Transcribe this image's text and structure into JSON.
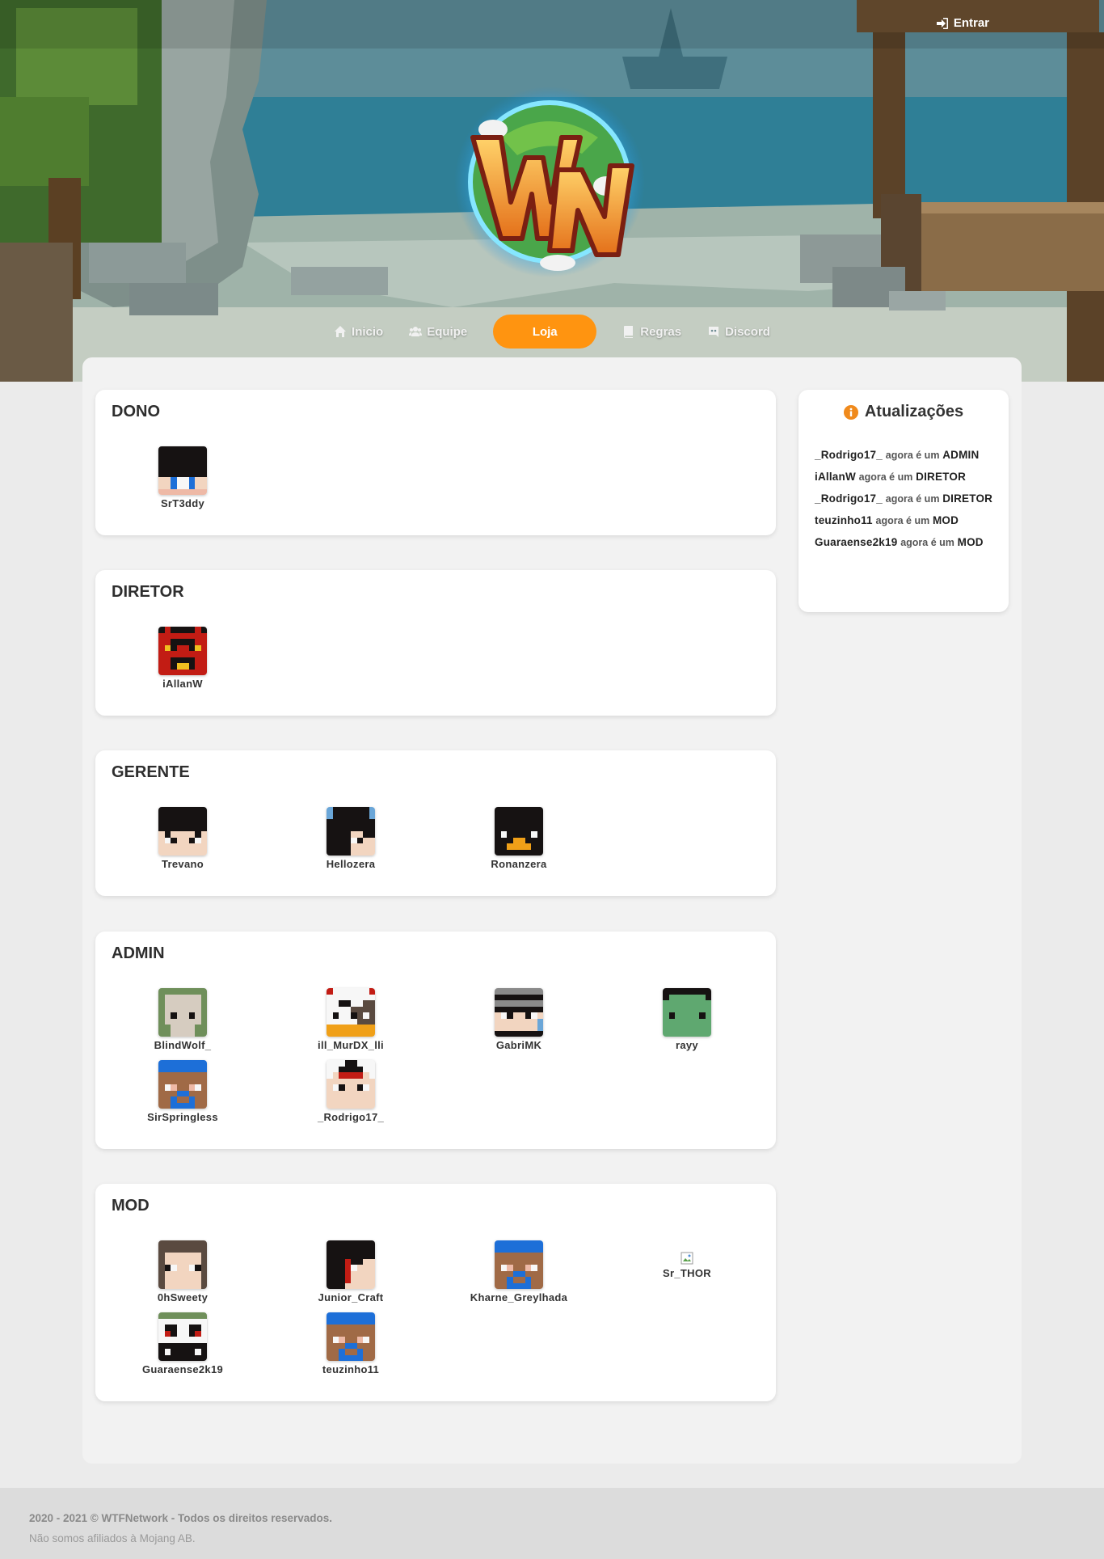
{
  "header": {
    "login_label": "Entrar"
  },
  "nav": {
    "items": [
      {
        "label": "Inicio",
        "icon": "home-icon"
      },
      {
        "label": "Equipe",
        "icon": "users-icon"
      },
      {
        "label": "Loja",
        "icon": "",
        "active": true
      },
      {
        "label": "Regras",
        "icon": "book-icon"
      },
      {
        "label": "Discord",
        "icon": "discord-icon"
      }
    ],
    "active_color": "#ff9410"
  },
  "groups": [
    {
      "title": "DONO",
      "members": [
        "SrT3ddy"
      ]
    },
    {
      "title": "DIRETOR",
      "members": [
        "iAllanW"
      ]
    },
    {
      "title": "GERENTE",
      "members": [
        "Trevano",
        "Hellozera",
        "Ronanzera"
      ]
    },
    {
      "title": "ADMIN",
      "members": [
        "BlindWolf_",
        "ill_MurDX_lli",
        "GabriMK",
        "rayy",
        "SirSpringless",
        "_Rodrigo17_"
      ]
    },
    {
      "title": "MOD",
      "members": [
        "0hSweety",
        "Junior_Craft",
        "Kharne_Greylhada",
        "Sr_THOR",
        "Guaraense2k19",
        "teuzinho11"
      ]
    }
  ],
  "updates": {
    "title": "Atualizações",
    "icon": "info-icon",
    "entries": [
      {
        "user": "_Rodrigo17_",
        "text": "agora é um",
        "role": "ADMIN"
      },
      {
        "user": "iAllanW",
        "text": "agora é um",
        "role": "DIRETOR"
      },
      {
        "user": "_Rodrigo17_",
        "text": "agora é um",
        "role": "DIRETOR"
      },
      {
        "user": "teuzinho11",
        "text": "agora é um",
        "role": "MOD"
      },
      {
        "user": "Guaraense2k19",
        "text": "agora é um",
        "role": "MOD"
      }
    ]
  },
  "footer": {
    "copyright": "2020 - 2021 © WTFNetwork - Todos os direitos reservados.",
    "disclaimer": "Não somos afiliados à Mojang AB."
  }
}
